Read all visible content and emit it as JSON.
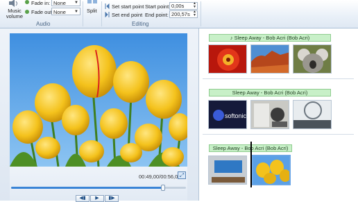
{
  "ribbon": {
    "audio": {
      "music_volume_label": "Music volume",
      "fade_in_label": "Fade in:",
      "fade_in_value": "None",
      "fade_out_label": "Fade out:",
      "fade_out_value": "None",
      "group_label": "Audio"
    },
    "editing": {
      "split_label": "Split",
      "set_start_label": "Set start point",
      "set_end_label": "Set end point",
      "start_point_label": "Start point:",
      "start_point_value": "0,00s",
      "end_point_label": "End point:",
      "end_point_value": "200,57s",
      "group_label": "Editing"
    }
  },
  "preview": {
    "timecode": "00:49,00/00:56,00",
    "seek_progress": 0.87,
    "fullscreen_icon": "fullscreen-icon",
    "buttons": [
      "previous-frame-icon",
      "play-icon",
      "next-frame-icon"
    ]
  },
  "storyboard": {
    "audio_tracks": [
      {
        "label": "♪ Sleep Away - Bob Acri (Bob Acri)"
      },
      {
        "label": "Sleep Away - Bob Acri (Bob Acri)"
      },
      {
        "label": "Sleep Away - Bob Acri (Bob Acri)"
      }
    ],
    "colors": {
      "audio_bar": "#c8f0c8",
      "selection": "#6aa6e6"
    }
  }
}
